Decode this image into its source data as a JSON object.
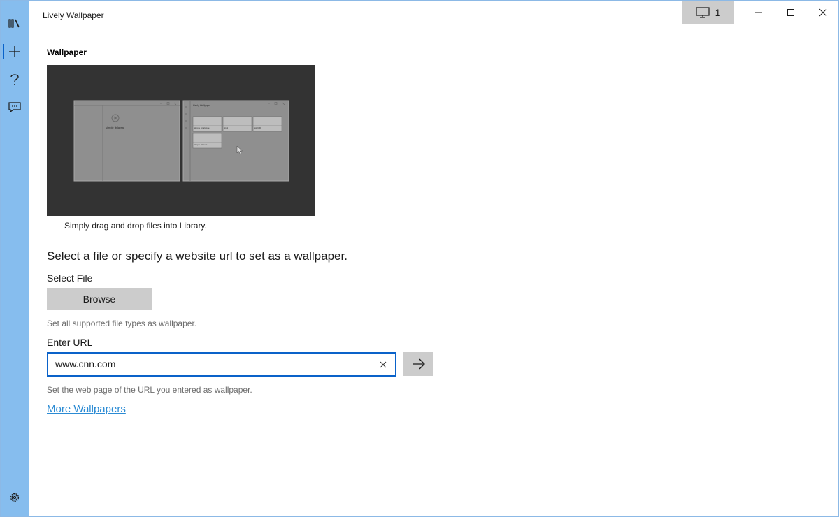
{
  "window": {
    "title": "Lively Wallpaper"
  },
  "titlebar": {
    "monitor_count": "1"
  },
  "rail": {
    "items": [
      {
        "name": "library",
        "icon": "library-icon"
      },
      {
        "name": "add",
        "icon": "plus-icon",
        "active": true
      },
      {
        "name": "help",
        "icon": "help-icon"
      },
      {
        "name": "feedback",
        "icon": "feedback-icon"
      }
    ],
    "bottom": {
      "name": "settings",
      "icon": "gear-icon"
    }
  },
  "main": {
    "section_title": "Wallpaper",
    "preview_caption": "Simply drag and drop files into Library.",
    "headline": "Select a file or specify a website url to set as a wallpaper.",
    "select_file_label": "Select File",
    "browse_label": "Browse",
    "browse_hint": "Set all supported file types as wallpaper.",
    "url_label": "Enter URL",
    "url_value": "www.cnn.com",
    "url_hint": "Set the web page of the URL you entered as wallpaper.",
    "more_link": "More Wallpapers"
  },
  "preview": {
    "left_window_label": "simple_bilareal",
    "right_window_title": "Lively Wallpaper",
    "tiles": [
      "Simple Analogue",
      "pixel",
      "Spirit III",
      "Simple Clouds"
    ]
  },
  "colors": {
    "rail": "#86bdee",
    "accent": "#0a62c9",
    "link": "#2b8bd4",
    "button": "#cccccc",
    "preview_bg": "#333333"
  }
}
